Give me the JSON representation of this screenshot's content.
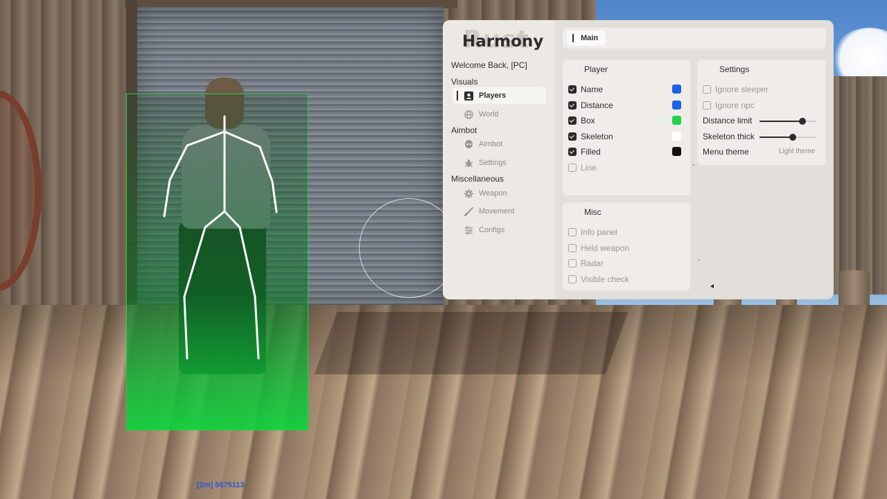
{
  "menu": {
    "brand_bg": "Rust",
    "brand": "Harmony",
    "welcome": "Welcome Back, [PC]",
    "sections": {
      "visuals": "Visuals",
      "aimbot": "Aimbot",
      "misc": "Miscellaneous"
    },
    "nav": {
      "players": "Players",
      "world": "World",
      "aimbot": "Aimbot",
      "settings": "Settings",
      "weapon": "Weapon",
      "movement": "Movement",
      "configs": "Configs"
    },
    "active_nav": "players",
    "tab": "Main"
  },
  "player_panel": {
    "title": "Player",
    "items": [
      {
        "label": "Name",
        "checked": true,
        "color": "#1565e6"
      },
      {
        "label": "Distance",
        "checked": true,
        "color": "#1565e6"
      },
      {
        "label": "Box",
        "checked": true,
        "color": "#1fd34a"
      },
      {
        "label": "Skeleton",
        "checked": true,
        "color": "#ffffff"
      },
      {
        "label": "Filled",
        "checked": true,
        "color": "#111111"
      },
      {
        "label": "Line",
        "checked": false
      }
    ]
  },
  "settings_panel": {
    "title": "Settings",
    "ignore_sleeper": {
      "label": "Ignore sleeper",
      "checked": false
    },
    "ignore_npc": {
      "label": "Ignore npc",
      "checked": false
    },
    "distance_limit": {
      "label": "Distance limit",
      "value": 0.76
    },
    "skeleton_thick": {
      "label": "Skeleton thick",
      "value": 0.58
    },
    "menu_theme": {
      "label": "Menu theme",
      "value": "Light theme"
    }
  },
  "misc_panel": {
    "title": "Misc",
    "items": [
      {
        "label": "Info panel",
        "checked": false
      },
      {
        "label": "Held weapon",
        "checked": false
      },
      {
        "label": "Radar",
        "checked": false
      },
      {
        "label": "Visible check",
        "checked": false
      }
    ]
  },
  "esp": {
    "label": "[2m] 5675113",
    "box_color": "#1fd34a",
    "skeleton_color": "#ffffff"
  },
  "icons": {
    "players": "user-square-icon",
    "world": "globe-icon",
    "aimbot": "alien-icon",
    "settings": "bug-icon",
    "weapon": "gear-icon",
    "movement": "brush-icon",
    "configs": "sliders-icon"
  }
}
